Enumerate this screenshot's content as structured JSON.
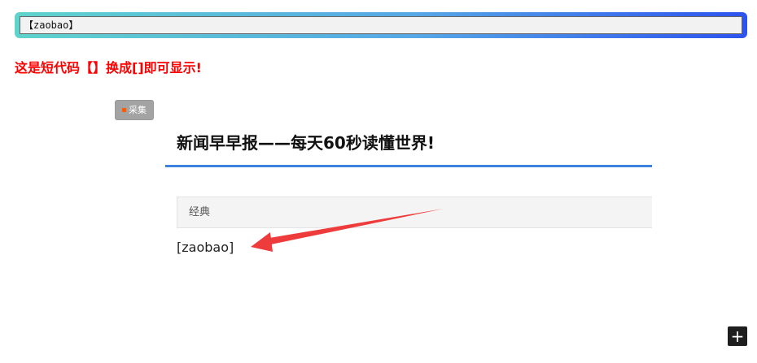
{
  "shortcode_box": {
    "text": "【zaobao】"
  },
  "notice": {
    "text": "这是短代码【】换成[]即可显示!"
  },
  "tag": {
    "label": "采集"
  },
  "article": {
    "title": "新闻早早报——每天60秒读懂世界!"
  },
  "category": {
    "label": "经典"
  },
  "output": {
    "text": "[zaobao]"
  },
  "colors": {
    "notice": "#ff0000",
    "divider": "#3e82e0",
    "arrow": "#ee3b3b",
    "tag_bg": "#a3a3a3",
    "tag_dot": "#ff5a00"
  },
  "icons": {
    "add": "plus-icon",
    "annotation": "arrow-annotation"
  }
}
